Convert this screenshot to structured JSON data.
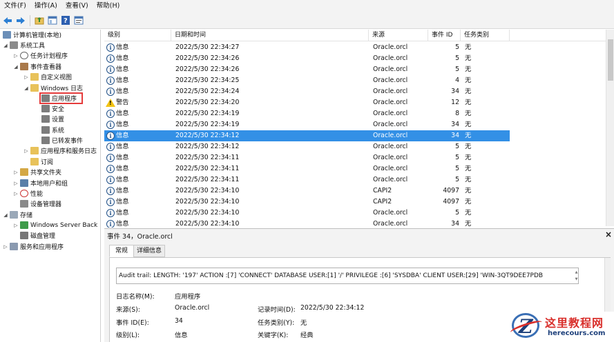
{
  "menu": [
    "文件(F)",
    "操作(A)",
    "查看(V)",
    "帮助(H)"
  ],
  "toolbar": {
    "icons": [
      "back-arrow-icon",
      "forward-arrow-icon",
      "up-folder-icon",
      "show-hide-tree-icon",
      "help-icon",
      "properties-icon"
    ]
  },
  "tree": {
    "root": "计算机管理(本地)",
    "system_tools": "系统工具",
    "task_scheduler": "任务计划程序",
    "event_viewer": "事件查看器",
    "custom_views": "自定义视图",
    "windows_logs": "Windows 日志",
    "application": "应用程序",
    "security": "安全",
    "setup": "设置",
    "system": "系统",
    "forwarded": "已转发事件",
    "apps_services": "应用程序和服务日志",
    "subscriptions": "订阅",
    "shared_folders": "共享文件夹",
    "local_users": "本地用户和组",
    "performance": "性能",
    "device_manager": "设备管理器",
    "storage": "存储",
    "windows_server_backup": "Windows Server Back",
    "disk_management": "磁盘管理",
    "services_apps": "服务和应用程序"
  },
  "grid": {
    "headers": [
      "级别",
      "日期和时间",
      "来源",
      "事件 ID",
      "任务类别"
    ],
    "rows": [
      {
        "level": "信息",
        "type": "info",
        "datetime": "2022/5/30 22:34:27",
        "source": "Oracle.orcl",
        "id": "5",
        "category": "无"
      },
      {
        "level": "信息",
        "type": "info",
        "datetime": "2022/5/30 22:34:26",
        "source": "Oracle.orcl",
        "id": "5",
        "category": "无"
      },
      {
        "level": "信息",
        "type": "info",
        "datetime": "2022/5/30 22:34:26",
        "source": "Oracle.orcl",
        "id": "5",
        "category": "无"
      },
      {
        "level": "信息",
        "type": "info",
        "datetime": "2022/5/30 22:34:25",
        "source": "Oracle.orcl",
        "id": "4",
        "category": "无"
      },
      {
        "level": "信息",
        "type": "info",
        "datetime": "2022/5/30 22:34:24",
        "source": "Oracle.orcl",
        "id": "34",
        "category": "无"
      },
      {
        "level": "警告",
        "type": "warn",
        "datetime": "2022/5/30 22:34:20",
        "source": "Oracle.orcl",
        "id": "12",
        "category": "无"
      },
      {
        "level": "信息",
        "type": "info",
        "datetime": "2022/5/30 22:34:19",
        "source": "Oracle.orcl",
        "id": "8",
        "category": "无"
      },
      {
        "level": "信息",
        "type": "info",
        "datetime": "2022/5/30 22:34:19",
        "source": "Oracle.orcl",
        "id": "34",
        "category": "无"
      },
      {
        "level": "信息",
        "type": "info",
        "datetime": "2022/5/30 22:34:12",
        "source": "Oracle.orcl",
        "id": "34",
        "category": "无",
        "selected": true
      },
      {
        "level": "信息",
        "type": "info",
        "datetime": "2022/5/30 22:34:12",
        "source": "Oracle.orcl",
        "id": "5",
        "category": "无"
      },
      {
        "level": "信息",
        "type": "info",
        "datetime": "2022/5/30 22:34:11",
        "source": "Oracle.orcl",
        "id": "5",
        "category": "无"
      },
      {
        "level": "信息",
        "type": "info",
        "datetime": "2022/5/30 22:34:11",
        "source": "Oracle.orcl",
        "id": "5",
        "category": "无"
      },
      {
        "level": "信息",
        "type": "info",
        "datetime": "2022/5/30 22:34:11",
        "source": "Oracle.orcl",
        "id": "5",
        "category": "无"
      },
      {
        "level": "信息",
        "type": "info",
        "datetime": "2022/5/30 22:34:10",
        "source": "CAPI2",
        "id": "4097",
        "category": "无"
      },
      {
        "level": "信息",
        "type": "info",
        "datetime": "2022/5/30 22:34:10",
        "source": "CAPI2",
        "id": "4097",
        "category": "无"
      },
      {
        "level": "信息",
        "type": "info",
        "datetime": "2022/5/30 22:34:10",
        "source": "Oracle.orcl",
        "id": "5",
        "category": "无"
      },
      {
        "level": "信息",
        "type": "info",
        "datetime": "2022/5/30 22:34:10",
        "source": "Oracle.orcl",
        "id": "34",
        "category": "无"
      }
    ]
  },
  "detail": {
    "title": "事件 34，Oracle.orcl",
    "close": "×",
    "tabs": [
      "常规",
      "详细信息"
    ],
    "message": "Audit trail: LENGTH: '197' ACTION :[7] 'CONNECT' DATABASE USER:[1] '/' PRIVILEGE :[6] 'SYSDBA' CLIENT USER:[29] 'WIN-3QT9DEE7PDB",
    "fields": {
      "log_name_label": "日志名称(M):",
      "log_name": "应用程序",
      "source_label": "来源(S):",
      "source": "Oracle.orcl",
      "logged_label": "记录时间(D):",
      "logged": "2022/5/30 22:34:12",
      "event_id_label": "事件 ID(E):",
      "event_id": "34",
      "task_label": "任务类别(Y):",
      "task": "无",
      "level_label": "级别(L):",
      "level": "信息",
      "keywords_label": "关键字(K):",
      "keywords": "经典"
    }
  },
  "watermark": {
    "cn": "这里教程网",
    "en": "herecours.com",
    "logo_letter": "Z"
  },
  "colors": {
    "selection": "#3390e6",
    "highlight_box": "#e53b3b",
    "warning": "#f2c314"
  }
}
